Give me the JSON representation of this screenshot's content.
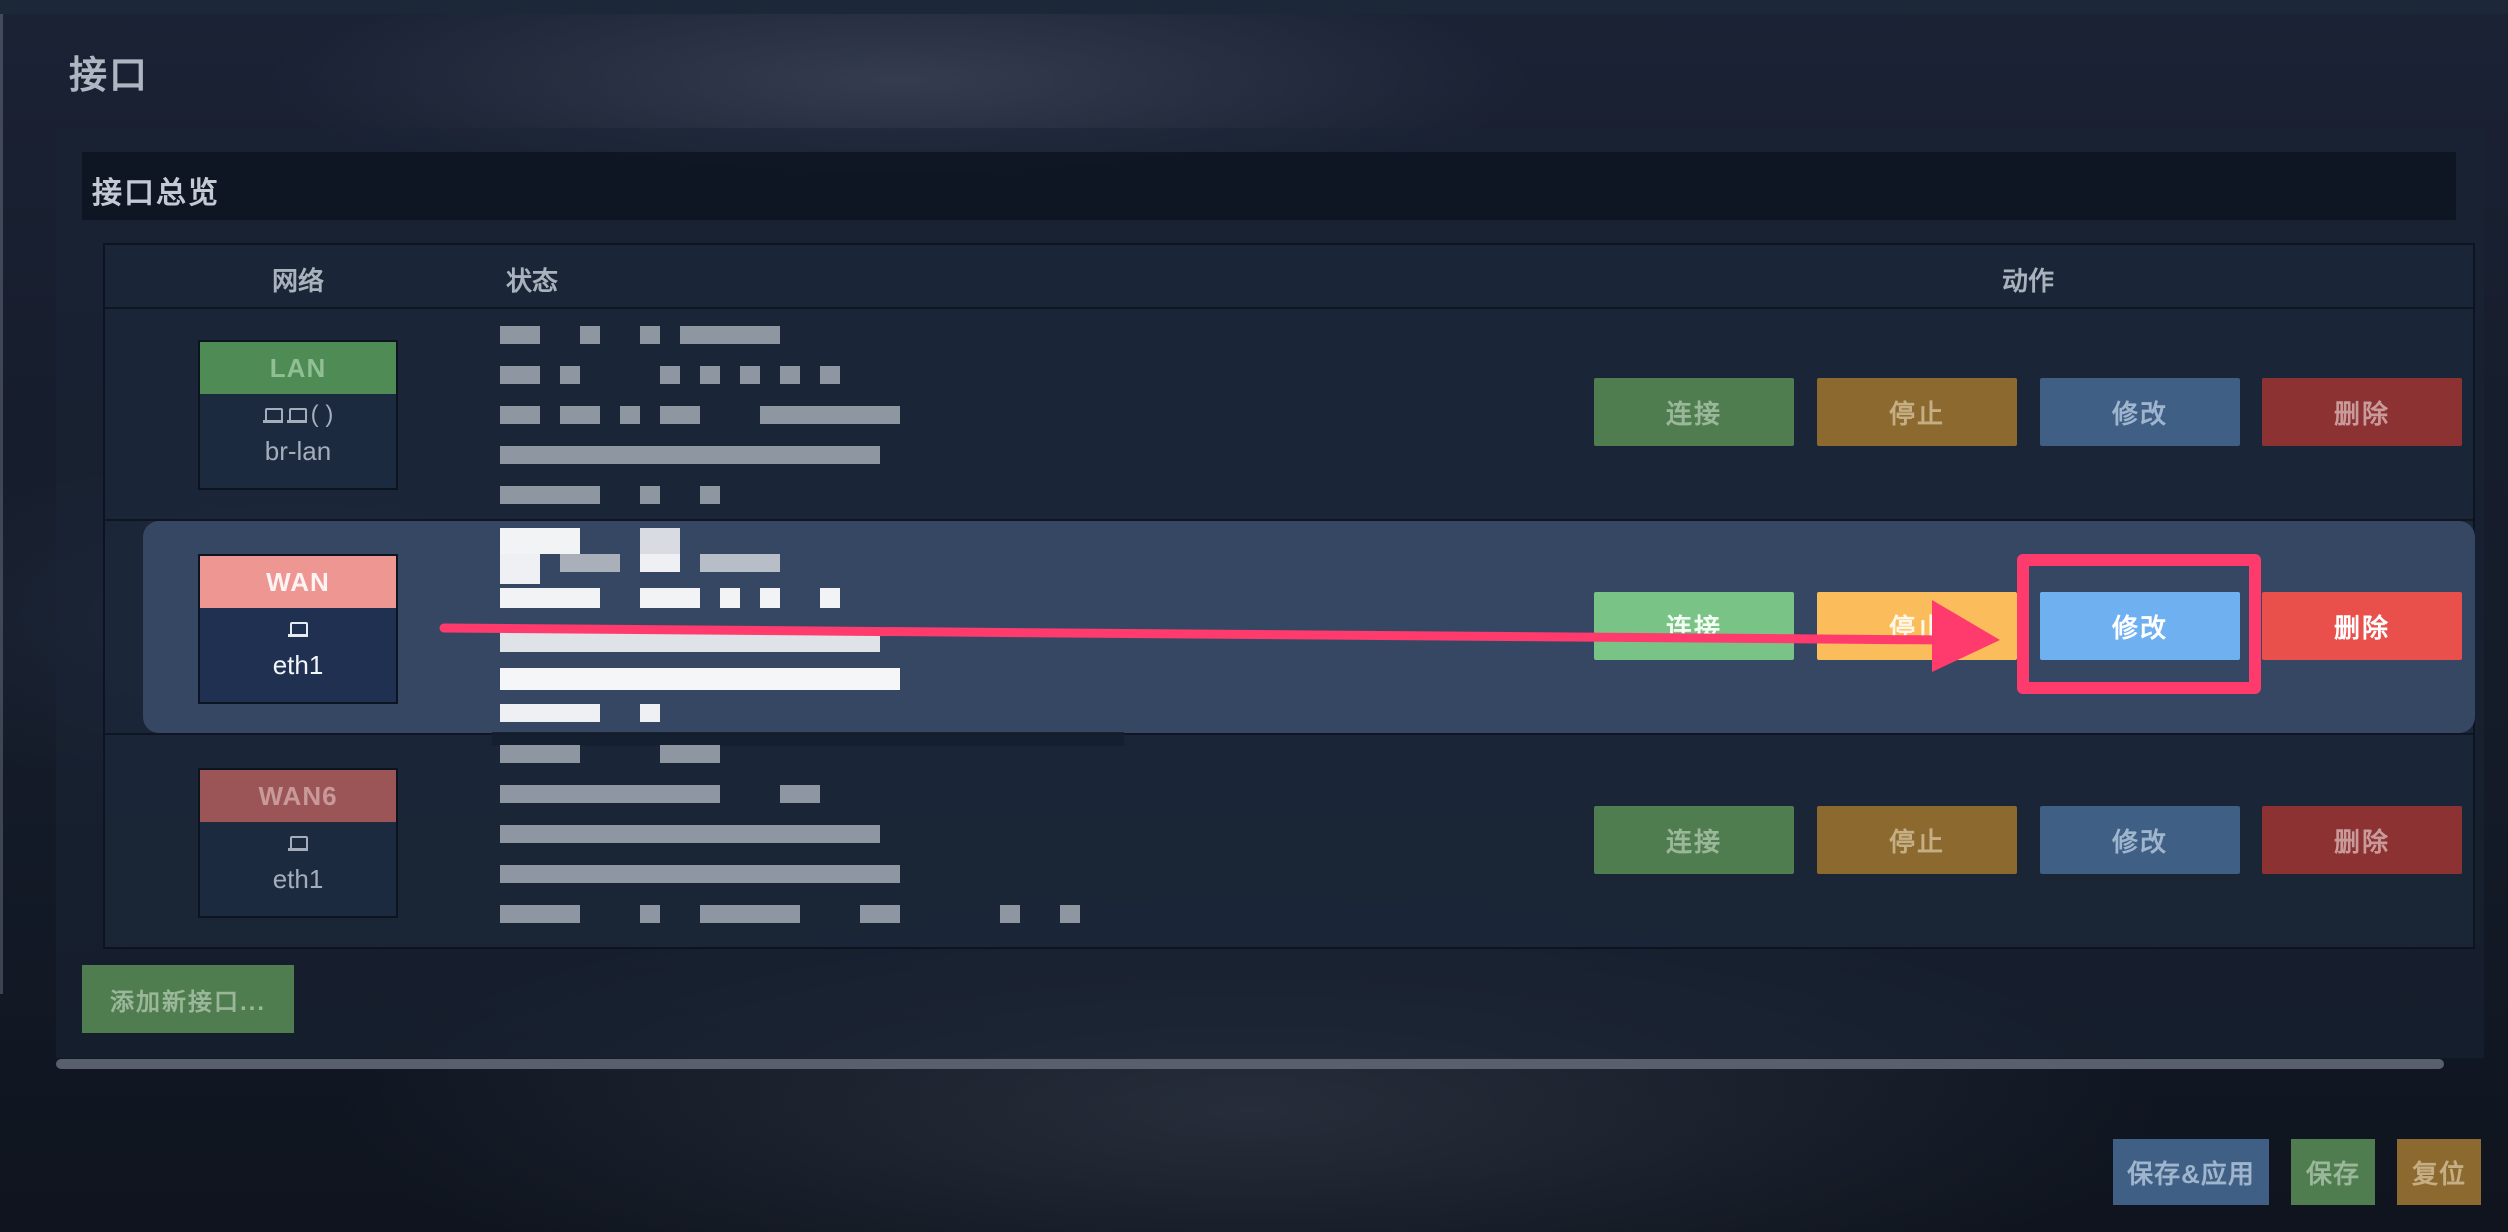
{
  "page": {
    "title": "接口"
  },
  "section": {
    "title": "接口总览"
  },
  "table": {
    "headers": {
      "network": "网络",
      "status": "状态",
      "actions": "动作"
    },
    "rows": [
      {
        "name": "LAN",
        "device": "br-lan",
        "icons": "(  )",
        "tag_bg": "#4f8b55",
        "tag_color": "#8fbf92"
      },
      {
        "name": "WAN",
        "device": "eth1",
        "icons": "",
        "tag_bg": "#ee9692",
        "tag_color": "#fff4f3"
      },
      {
        "name": "WAN6",
        "device": "eth1",
        "icons": "",
        "tag_bg": "#9c5556",
        "tag_color": "#c89999"
      }
    ],
    "actions": {
      "connect": "连接",
      "stop": "停止",
      "edit": "修改",
      "delete": "删除"
    }
  },
  "add_interface": "添加新接口...",
  "footer": {
    "save_apply": "保存&应用",
    "save": "保存",
    "reset": "复位"
  },
  "colors": {
    "annotation": "#ff3a6d"
  },
  "icons": {
    "device": "network-port-icon",
    "bridge": "bridge-icon"
  }
}
